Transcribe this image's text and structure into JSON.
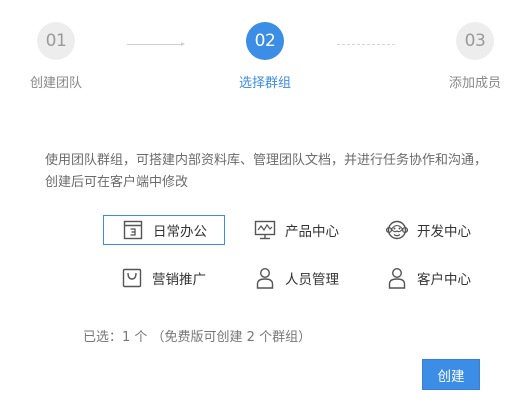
{
  "steps": [
    {
      "number": "01",
      "label": "创建团队",
      "state": "done"
    },
    {
      "number": "02",
      "label": "选择群组",
      "state": "active"
    },
    {
      "number": "03",
      "label": "添加成员",
      "state": "pending"
    }
  ],
  "description": "使用团队群组，可搭建内部资料库、管理团队文档，并进行任务协作和沟通，创建后可在客户端中修改",
  "options": [
    {
      "label": "日常办公",
      "icon": "calendar-icon",
      "selected": true
    },
    {
      "label": "产品中心",
      "icon": "monitor-icon",
      "selected": false
    },
    {
      "label": "开发中心",
      "icon": "monkey-icon",
      "selected": false
    },
    {
      "label": "营销推广",
      "icon": "shopping-bag-icon",
      "selected": false
    },
    {
      "label": "人员管理",
      "icon": "person-icon",
      "selected": false
    },
    {
      "label": "客户中心",
      "icon": "person-icon",
      "selected": false
    }
  ],
  "summary": "已选：1 个 （免费版可创建 2 个群组）",
  "create_button": "创建",
  "colors": {
    "accent": "#3b8de6",
    "inactive_circle": "#ededed",
    "muted_text": "#888888"
  }
}
